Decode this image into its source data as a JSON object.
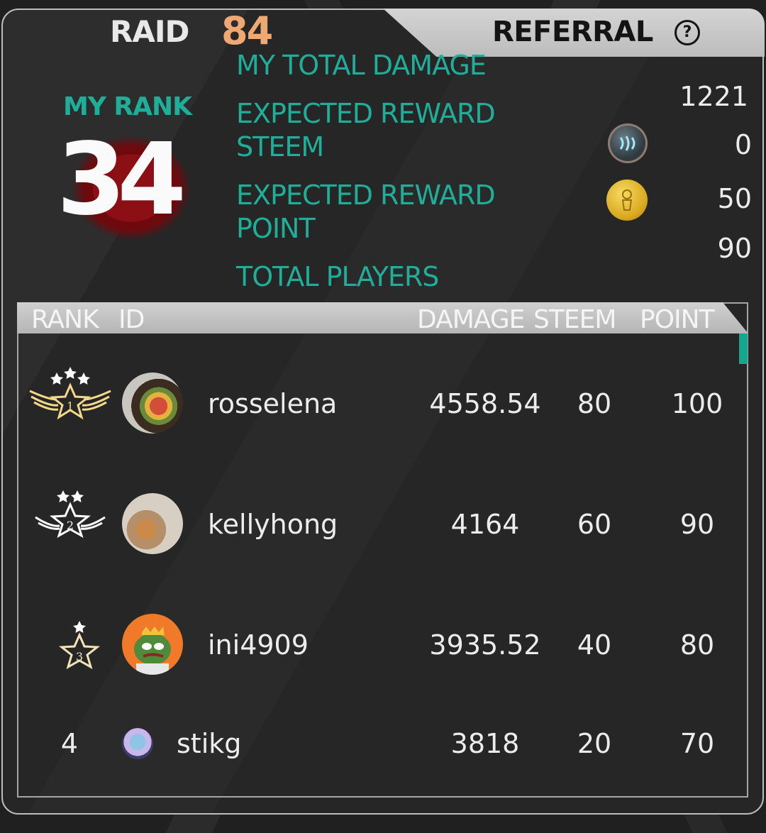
{
  "header": {
    "raid_label": "RAID",
    "raid_number": "84",
    "referral_label": "REFERRAL",
    "help_symbol": "?"
  },
  "summary": {
    "my_rank_label": "MY RANK",
    "my_rank_value": "34",
    "total_damage_label": "MY TOTAL DAMAGE",
    "total_damage_value": "1221",
    "expected_reward_steem_label_1": "EXPECTED REWARD",
    "expected_reward_steem_label_2": "STEEM",
    "expected_reward_steem_value": "0",
    "expected_reward_point_label_1": "EXPECTED REWARD",
    "expected_reward_point_label_2": "POINT",
    "expected_reward_point_value": "50",
    "total_players_label": "TOTAL PLAYERS",
    "total_players_value": "90"
  },
  "table": {
    "headers": {
      "rank": "RANK",
      "id": "ID",
      "damage": "DAMAGE",
      "steem": "STEEM",
      "point": "POINT"
    },
    "rows": [
      {
        "rank": "1",
        "name": "rosselena",
        "damage": "4558.54",
        "steem": "80",
        "point": "100"
      },
      {
        "rank": "2",
        "name": "kellyhong",
        "damage": "4164",
        "steem": "60",
        "point": "90"
      },
      {
        "rank": "3",
        "name": "ini4909",
        "damage": "3935.52",
        "steem": "40",
        "point": "80"
      },
      {
        "rank": "4",
        "name": "stikg",
        "damage": "3818",
        "steem": "20",
        "point": "70"
      }
    ]
  },
  "colors": {
    "accent_teal": "#1fae9a",
    "raid_orange": "#f0a873",
    "rank_blood": "#8b0f14"
  },
  "icons": {
    "steem_coin": "steem-coin-icon",
    "point_coin": "point-coin-icon",
    "rank1": "gold-winged-star-badge-icon",
    "rank2": "silver-winged-star-badge-icon",
    "rank3": "bronze-star-badge-icon"
  }
}
